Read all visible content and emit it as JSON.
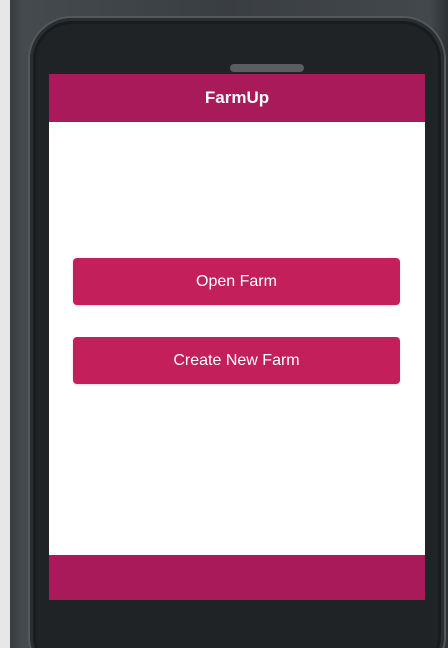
{
  "app": {
    "title": "FarmUp"
  },
  "main": {
    "open_farm_label": "Open Farm",
    "create_farm_label": "Create New Farm"
  },
  "colors": {
    "brand": "#a91a5a",
    "button": "#c21f5b",
    "screen_bg": "#ffffff",
    "device": "#1f2326"
  }
}
